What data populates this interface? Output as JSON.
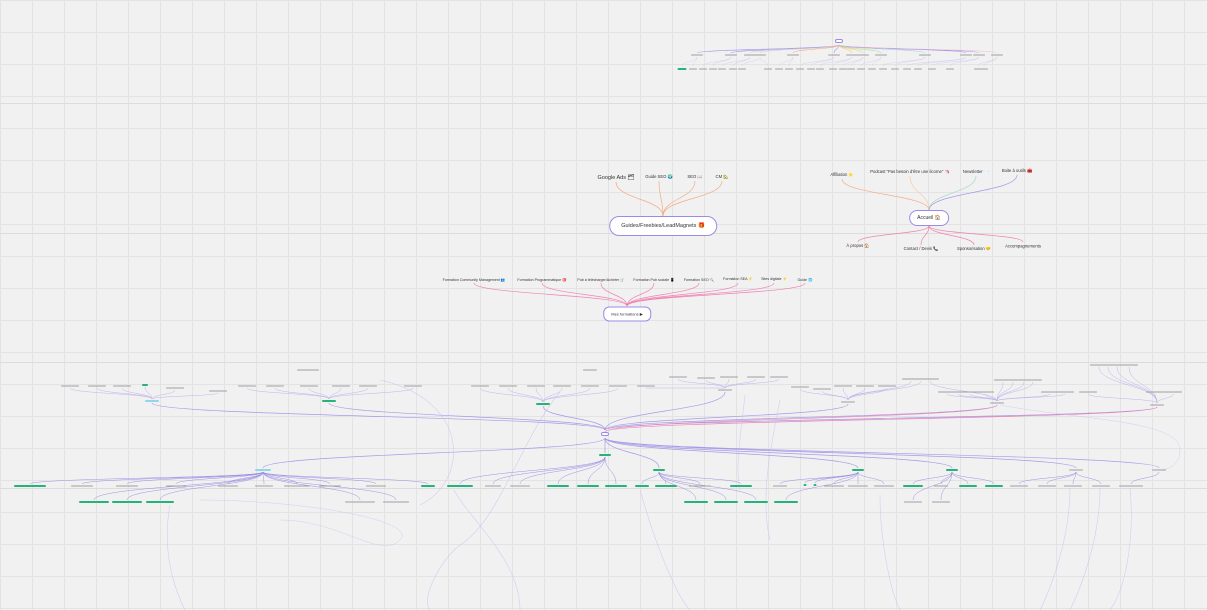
{
  "colors": {
    "background": "#f1f1f1",
    "grid": "#e3e3e3",
    "accent_purple": "#9a8be6",
    "accent_pink": "#f06fa8",
    "accent_orange": "#f4a071",
    "accent_green": "#25b37a",
    "accent_cyan": "#8fd6e8",
    "accent_lavender": "#c8bff0"
  },
  "guides": {
    "hub": "Guides/Freebies/LeadMagnets 🎁",
    "children": [
      "Google Ads 🗂",
      "Guide SEO 🌍",
      "SEO 📖",
      "CM 🏡"
    ]
  },
  "accueil": {
    "hub": "Accueil 🏠",
    "top_children": [
      "Affiliation ⭐",
      "Podcast \"Pas besoin d'être une licorne\" 🦄",
      "Newsletter ✉️",
      "Boite à outils 🧰"
    ],
    "bottom_children": [
      "À propos 🏠",
      "Contact / Devis 📞",
      "Sponsorisation 🤝",
      "Accompagnements"
    ]
  },
  "formations": {
    "hub": "Mes formations ▶",
    "children": [
      "Formation Community Management 👥",
      "Formation Programmatique 🎯",
      "Pub à télécharger/Acheter 🛒",
      "Formation Pub sociale 📱",
      "Formation SEO 🔍",
      "Formation SEA ⚡",
      "Sites digitale ⚡",
      "Guide 🌐"
    ]
  }
}
